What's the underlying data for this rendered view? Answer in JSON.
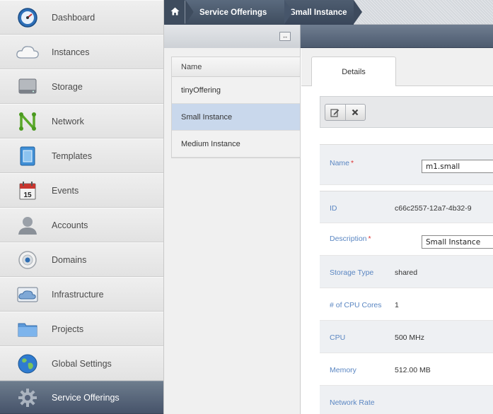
{
  "sidebar": {
    "items": [
      {
        "label": "Dashboard",
        "icon": "dashboard-icon"
      },
      {
        "label": "Instances",
        "icon": "cloud-icon"
      },
      {
        "label": "Storage",
        "icon": "storage-icon"
      },
      {
        "label": "Network",
        "icon": "network-icon"
      },
      {
        "label": "Templates",
        "icon": "templates-icon"
      },
      {
        "label": "Events",
        "icon": "calendar-icon",
        "icon_text": "15"
      },
      {
        "label": "Accounts",
        "icon": "user-icon"
      },
      {
        "label": "Domains",
        "icon": "domains-icon"
      },
      {
        "label": "Infrastructure",
        "icon": "infrastructure-icon"
      },
      {
        "label": "Projects",
        "icon": "folder-icon"
      },
      {
        "label": "Global Settings",
        "icon": "globe-icon"
      },
      {
        "label": "Service Offerings",
        "icon": "gear-icon",
        "active": true
      }
    ]
  },
  "breadcrumb": {
    "home_icon": "home-icon",
    "items": [
      "Service Offerings",
      "Small Instance"
    ]
  },
  "list": {
    "header": "Name",
    "rows": [
      "tinyOffering",
      "Small Instance",
      "Medium Instance"
    ],
    "selected": "Small Instance"
  },
  "detail": {
    "tab": "Details",
    "actions": [
      "edit-icon",
      "remove-icon"
    ],
    "fields": {
      "name": {
        "label": "Name",
        "required": "*",
        "value": "m1.small"
      },
      "id": {
        "label": "ID",
        "value": "c66c2557-12a7-4b32-9"
      },
      "description": {
        "label": "Description",
        "required": "*",
        "value": "Small Instance"
      },
      "storage_type": {
        "label": "Storage Type",
        "value": "shared"
      },
      "cpu_cores": {
        "label": "# of CPU Cores",
        "value": "1"
      },
      "cpu": {
        "label": "CPU",
        "value": "500 MHz"
      },
      "memory": {
        "label": "Memory",
        "value": "512.00 MB"
      },
      "network_rate": {
        "label": "Network Rate",
        "value": ""
      }
    }
  },
  "colors": {
    "active_nav": "#46536a",
    "selected_row": "#c9d8ec",
    "label_blue": "#5a86c2",
    "required_red": "#dd3333"
  }
}
